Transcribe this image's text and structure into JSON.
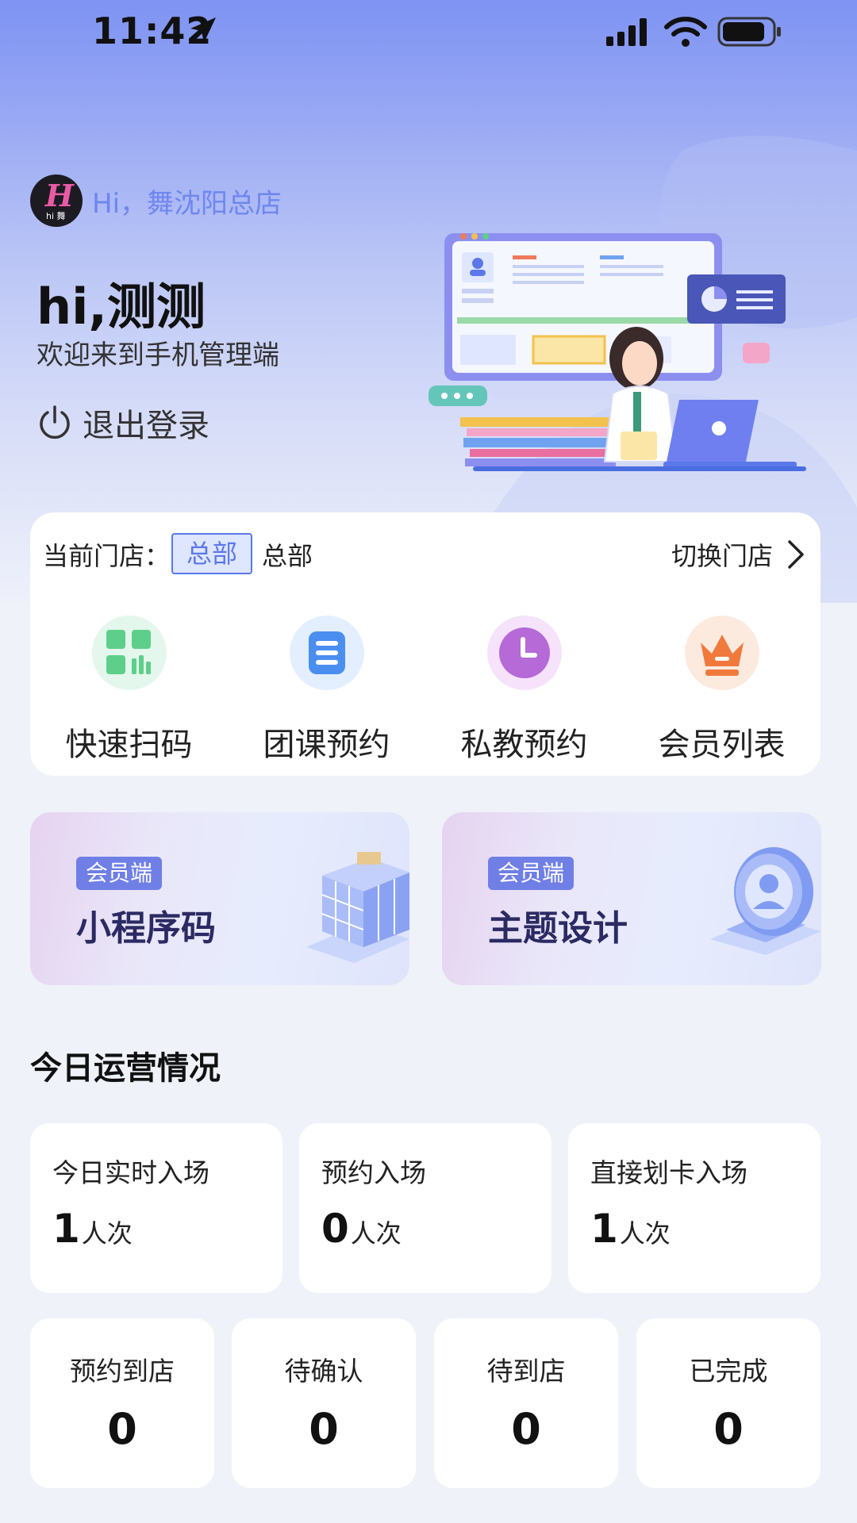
{
  "status_bar": {
    "time": "11:42"
  },
  "header": {
    "store_greeting": "Hi，舞沈阳总店",
    "logo_text": "hi 舞",
    "title": "hi,测测",
    "welcome": "欢迎来到手机管理端",
    "logout_label": "退出登录"
  },
  "store_card": {
    "current_label": "当前门店：",
    "badge": "总部",
    "store_name": "总部",
    "switch_label": "切换门店",
    "quick_actions": [
      {
        "label": "快速扫码",
        "icon": "scan-grid-icon",
        "color": "#5dcf8a"
      },
      {
        "label": "团课预约",
        "icon": "list-icon",
        "color": "#4a8ff0"
      },
      {
        "label": "私教预约",
        "icon": "clock-icon",
        "color": "#b56ad8"
      },
      {
        "label": "会员列表",
        "icon": "crown-icon",
        "color": "#f07a3c"
      }
    ]
  },
  "banners": [
    {
      "tag": "会员端",
      "title": "小程序码"
    },
    {
      "tag": "会员端",
      "title": "主题设计"
    }
  ],
  "operations": {
    "title": "今日运营情况",
    "top_stats": [
      {
        "label": "今日实时入场",
        "value": "1",
        "unit": "人次"
      },
      {
        "label": "预约入场",
        "value": "0",
        "unit": "人次"
      },
      {
        "label": "直接划卡入场",
        "value": "1",
        "unit": "人次"
      }
    ],
    "bottom_stats": [
      {
        "label": "预约到店",
        "value": "0"
      },
      {
        "label": "待确认",
        "value": "0"
      },
      {
        "label": "待到店",
        "value": "0"
      },
      {
        "label": "已完成",
        "value": "0"
      }
    ]
  },
  "colors": {
    "accent": "#5b78e8",
    "hero_top": "#7e93f3",
    "page_bg": "#eff2f8"
  }
}
